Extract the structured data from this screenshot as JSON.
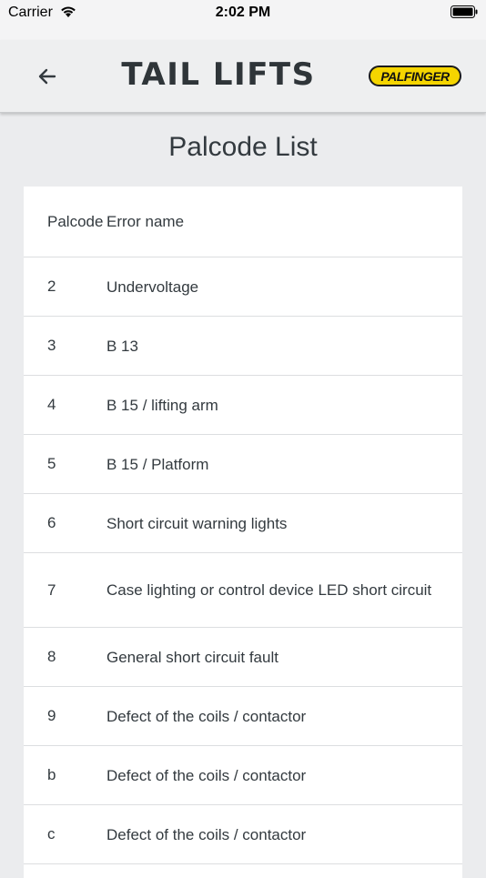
{
  "status": {
    "carrier": "Carrier",
    "time": "2:02 PM"
  },
  "header": {
    "title": "TAIL LIFTS",
    "brand": "PALFINGER"
  },
  "page_title": "Palcode List",
  "table": {
    "headers": {
      "code": "Palcode",
      "name": "Error name"
    },
    "rows": [
      {
        "code": "2",
        "name": "Undervoltage"
      },
      {
        "code": "3",
        "name": "B 13"
      },
      {
        "code": "4",
        "name": "B 15 / lifting arm"
      },
      {
        "code": "5",
        "name": "B 15 / Platform"
      },
      {
        "code": "6",
        "name": "Short circuit warning lights"
      },
      {
        "code": "7",
        "name": "Case lighting or control device LED short circuit"
      },
      {
        "code": "8",
        "name": "General short circuit fault"
      },
      {
        "code": "9",
        "name": "Defect of the coils / contactor"
      },
      {
        "code": "b",
        "name": "Defect of the coils / contactor"
      },
      {
        "code": "c",
        "name": "Defect of the coils / contactor"
      }
    ]
  },
  "colors": {
    "background": "#ebecee",
    "brand_yellow": "#f5d500",
    "text": "#333a3f"
  }
}
